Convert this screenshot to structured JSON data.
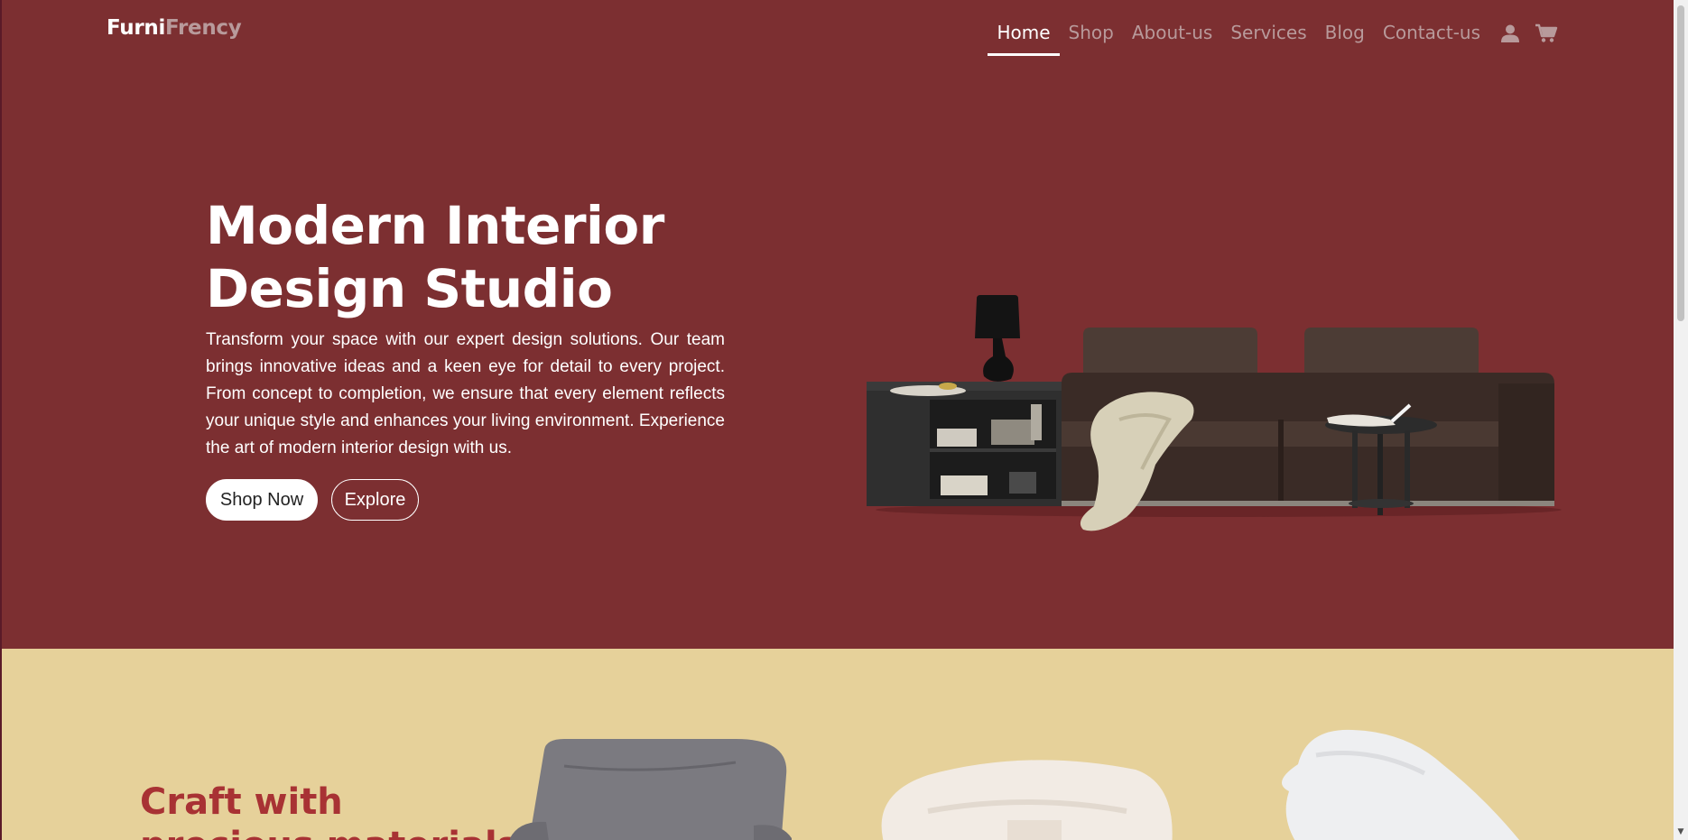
{
  "brand": {
    "part1": "Furni",
    "part2": "Frency"
  },
  "nav": {
    "items": [
      {
        "label": "Home",
        "active": true
      },
      {
        "label": "Shop"
      },
      {
        "label": "About-us"
      },
      {
        "label": "Services"
      },
      {
        "label": "Blog"
      },
      {
        "label": "Contact-us"
      }
    ],
    "icons": [
      "user-icon",
      "cart-icon"
    ]
  },
  "hero": {
    "title": "Modern Interior Design Studio",
    "text": "Transform your space with our expert design solutions. Our team brings innovative ideas and a keen eye for detail to every project. From concept to completion, we ensure that every element reflects your unique style and enhances your living environment. Experience the art of modern interior design with us.",
    "primary_button": "Shop Now",
    "secondary_button": "Explore",
    "image": "sofa-with-side-table-and-lamp"
  },
  "section2": {
    "title": "Craft with precious materials"
  },
  "colors": {
    "hero_bg": "#7c2f31",
    "section2_bg": "#e6d19a",
    "accent_red": "#a83234",
    "nav_muted": "#b89a9b"
  }
}
